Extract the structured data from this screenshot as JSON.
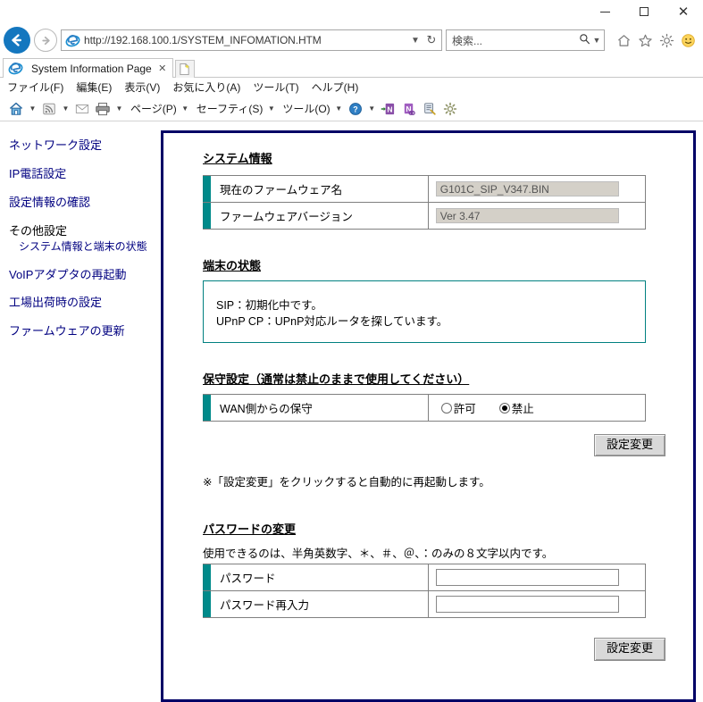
{
  "window": {
    "minimize_label": "–",
    "maximize_label": "□",
    "close_label": "✕"
  },
  "browser": {
    "back_icon": "back-arrow-icon",
    "forward_icon": "forward-arrow-icon",
    "url": "http://192.168.100.1/SYSTEM_INFOMATION.HTM",
    "url_caret": "▼",
    "refresh_glyph": "↻",
    "search_placeholder": "検索...",
    "search_glyph": "⌕",
    "search_caret": "▼",
    "chrome_icons": [
      "home-icon",
      "favorites-star-icon",
      "settings-gear-icon",
      "smiley-feedback-icon"
    ],
    "tab": {
      "title": "System Information Page",
      "close_label": "✕"
    },
    "new_tab_label": "",
    "menu_items": [
      "ファイル(F)",
      "編集(E)",
      "表示(V)",
      "お気に入り(A)",
      "ツール(T)",
      "ヘルプ(H)"
    ],
    "command_bar": {
      "page_label": "ページ(P)",
      "safety_label": "セーフティ(S)",
      "tools_label": "ツール(O)",
      "caret": "▼"
    }
  },
  "sidebar": {
    "items": [
      {
        "label": "ネットワーク設定",
        "name": "sidebar-item-network-settings"
      },
      {
        "label": "IP電話設定",
        "name": "sidebar-item-ip-phone-settings"
      },
      {
        "label": "設定情報の確認",
        "name": "sidebar-item-config-check"
      }
    ],
    "group": {
      "title": "その他設定",
      "sub_label": "システム情報と端末の状態"
    },
    "items_after": [
      {
        "label": "VoIPアダプタの再起動",
        "name": "sidebar-item-restart-voip-adapter"
      },
      {
        "label": "工場出荷時の設定",
        "name": "sidebar-item-factory-defaults"
      },
      {
        "label": "ファームウェアの更新",
        "name": "sidebar-item-firmware-update"
      }
    ]
  },
  "page": {
    "system_info": {
      "heading": "システム情報",
      "rows": [
        {
          "label": "現在のファームウェア名",
          "value": "G101C_SIP_V347.BIN"
        },
        {
          "label": "ファームウェアバージョン",
          "value": "Ver 3.47"
        }
      ]
    },
    "device_status": {
      "heading": "端末の状態",
      "lines": [
        "SIP：初期化中です。",
        "UPnP CP：UPnP対応ルータを探しています。"
      ]
    },
    "maintenance": {
      "heading": "保守設定（通常は禁止のままで使用してください）",
      "row_label": "WAN側からの保守",
      "options": [
        {
          "label": "許可",
          "selected": false
        },
        {
          "label": "禁止",
          "selected": true
        }
      ],
      "apply_button": "設定変更",
      "note": "※「設定変更」をクリックすると自動的に再起動します。"
    },
    "password_change": {
      "heading": "パスワードの変更",
      "hint": "使用できるのは、半角英数字、＊、＃、＠、：のみの８文字以内です。",
      "rows": [
        {
          "label": "パスワード",
          "value": ""
        },
        {
          "label": "パスワード再入力",
          "value": ""
        }
      ],
      "apply_button": "設定変更"
    }
  },
  "colors": {
    "frame_navy": "#000066",
    "accent_teal": "#008a8a",
    "table_border_teal": "#008080",
    "link_navy": "#000080",
    "readonly_bg": "#d4d0c8"
  }
}
